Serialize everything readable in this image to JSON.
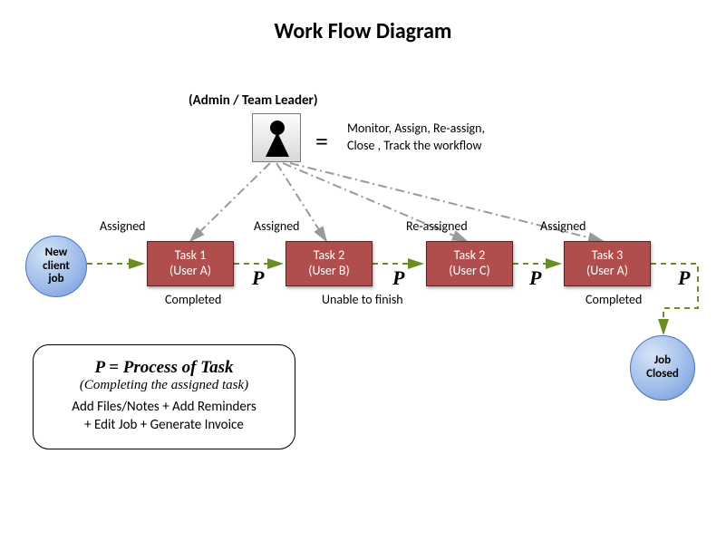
{
  "title": "Work Flow Diagram",
  "admin": {
    "label": "(Admin / Team Leader)",
    "equals": "=",
    "desc_line1": "Monitor, Assign, Re-assign,",
    "desc_line2": "Close , Track the workflow"
  },
  "start": {
    "line1": "New",
    "line2": "client",
    "line3": "job"
  },
  "end": {
    "line1": "Job",
    "line2": "Closed"
  },
  "tasks": [
    {
      "title": "Task 1",
      "user": "(User A)"
    },
    {
      "title": "Task 2",
      "user": "(User B)"
    },
    {
      "title": "Task 2",
      "user": "(User C)"
    },
    {
      "title": "Task 3",
      "user": "(User A)"
    }
  ],
  "labels": {
    "assigned1": "Assigned",
    "assigned2": "Assigned",
    "reassigned": "Re-assigned",
    "assigned4": "Assigned",
    "completed1": "Completed",
    "unable": "Unable to finish",
    "completed2": "Completed"
  },
  "P_symbol": "P",
  "legend": {
    "l1": "P = Process of Task",
    "l2": "(Completing the assigned task)",
    "l3a": "Add Files/Notes + Add Reminders",
    "l3b": "+ Edit Job + Generate Invoice"
  },
  "colors": {
    "task_bg": "#b04d4d",
    "arrow": "#6b8e23",
    "admin_line": "#999999"
  }
}
